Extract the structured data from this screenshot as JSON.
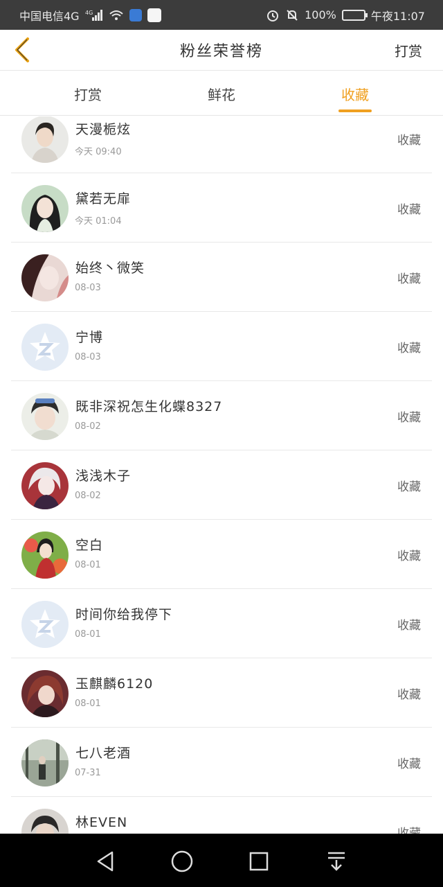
{
  "status_bar": {
    "carrier": "中国电信4G",
    "network": "4G",
    "battery": "100%",
    "time": "午夜11:07"
  },
  "header": {
    "title": "粉丝荣誉榜",
    "action": "打赏"
  },
  "tabs": [
    {
      "label": "打赏"
    },
    {
      "label": "鲜花"
    },
    {
      "label": "收藏"
    }
  ],
  "active_tab": 2,
  "accent_color": "#f0a020",
  "rows": [
    {
      "name": "天漫栀炫",
      "date": "今天 09:40",
      "action": "收藏",
      "avatar": "photo"
    },
    {
      "name": "黛若无扉",
      "date": "今天 01:04",
      "action": "收藏",
      "avatar": "photo"
    },
    {
      "name": "始终丶微笑",
      "date": "08-03",
      "action": "收藏",
      "avatar": "photo"
    },
    {
      "name": "宁博",
      "date": "08-03",
      "action": "收藏",
      "avatar": "default-qq-icon"
    },
    {
      "name": "既非深祝怎生化蝶8327",
      "date": "08-02",
      "action": "收藏",
      "avatar": "photo"
    },
    {
      "name": "浅浅木子",
      "date": "08-02",
      "action": "收藏",
      "avatar": "photo"
    },
    {
      "name": "空白",
      "date": "08-01",
      "action": "收藏",
      "avatar": "photo"
    },
    {
      "name": "时间你给我停下",
      "date": "08-01",
      "action": "收藏",
      "avatar": "default-qq-icon"
    },
    {
      "name": "玉麒麟6120",
      "date": "08-01",
      "action": "收藏",
      "avatar": "photo"
    },
    {
      "name": "七八老酒",
      "date": "07-31",
      "action": "收藏",
      "avatar": "photo"
    },
    {
      "name": "林EVEN",
      "date": "",
      "action": "收藏",
      "avatar": "photo"
    }
  ]
}
